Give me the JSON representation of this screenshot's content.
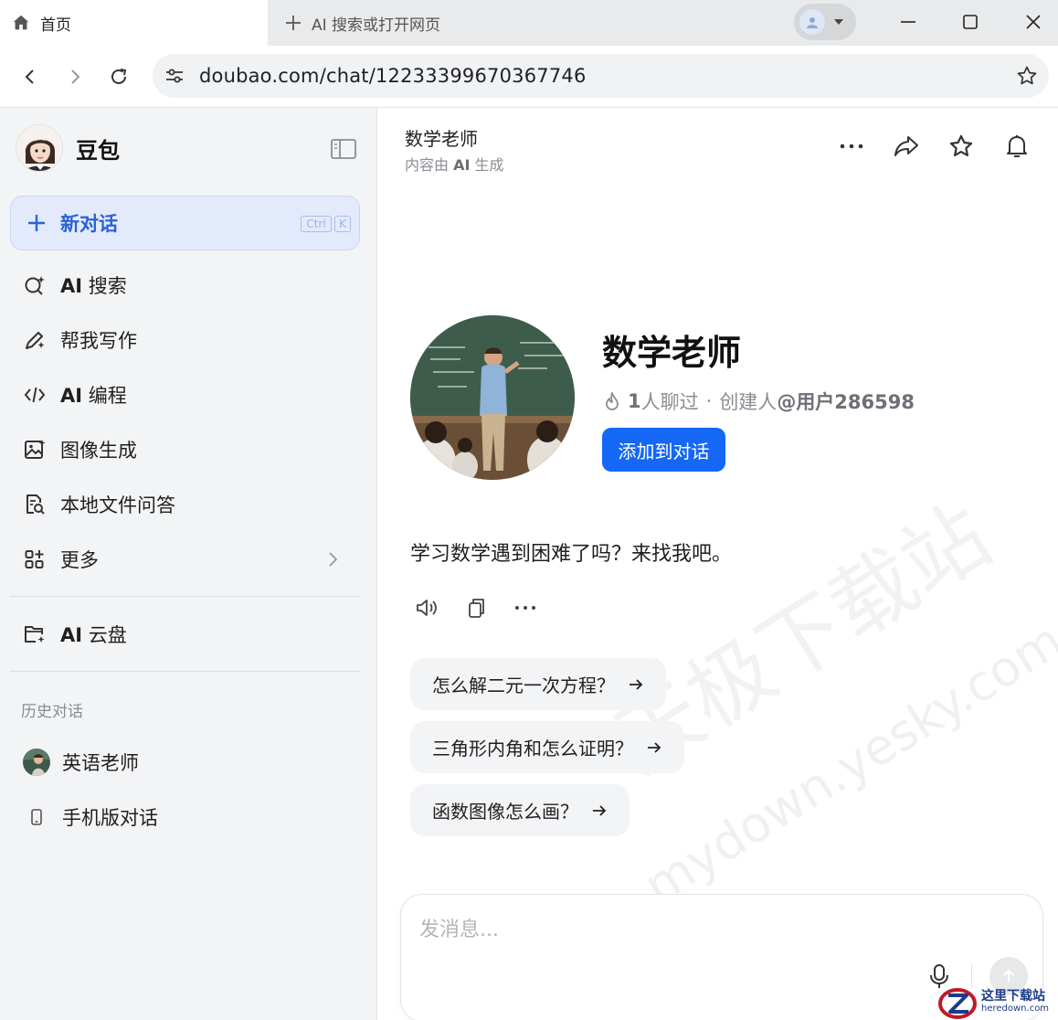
{
  "browser": {
    "active_tab_title": "首页",
    "new_tab_label": "AI 搜索或打开网页",
    "url": "doubao.com/chat/12233399670367746"
  },
  "sidebar": {
    "brand": "豆包",
    "new_chat": {
      "label": "新对话",
      "shortcut_key1": "Ctrl",
      "shortcut_key2": "K"
    },
    "items": [
      {
        "label_bold": "AI",
        "label": " 搜索",
        "icon": "ai-search-icon"
      },
      {
        "label_bold": "",
        "label": "帮我写作",
        "icon": "pen-sparkle-icon"
      },
      {
        "label_bold": "AI",
        "label": " 编程",
        "icon": "code-icon"
      },
      {
        "label_bold": "",
        "label": "图像生成",
        "icon": "image-icon"
      },
      {
        "label_bold": "",
        "label": "本地文件问答",
        "icon": "file-search-icon"
      },
      {
        "label_bold": "",
        "label": "更多",
        "icon": "grid-icon"
      }
    ],
    "cloud": {
      "label_bold": "AI",
      "label": " 云盘"
    },
    "history_title": "历史对话",
    "history": [
      {
        "label": "英语老师",
        "icon": "teacher-avatar"
      },
      {
        "label": "手机版对话",
        "icon": "phone-icon"
      }
    ]
  },
  "header": {
    "title": "数学老师",
    "subtitle_prefix": "内容由 ",
    "subtitle_ai": "AI",
    "subtitle_suffix": " 生成"
  },
  "bot": {
    "name": "数学老师",
    "chat_count": "1",
    "chat_count_unit": " 人聊过",
    "separator": "·",
    "creator_prefix": "创建人 ",
    "creator": "@用户286598",
    "add_button": "添加到对话"
  },
  "greeting": "学习数学遇到困难了吗？来找我吧。",
  "suggestions": [
    "怎么解二元一次方程？",
    "三角形内角和怎么证明？",
    "函数图像怎么画？"
  ],
  "composer": {
    "placeholder": "发消息..."
  },
  "watermark": {
    "line1": "天极下载站",
    "line2": "mydown.yesky.com"
  },
  "corner_logo": {
    "main": "这里下载站",
    "sub": "heredown.com"
  },
  "colors": {
    "accent": "#1468f5",
    "new_chat_text": "#2a63d6",
    "sidebar_bg": "#f3f4f6"
  }
}
